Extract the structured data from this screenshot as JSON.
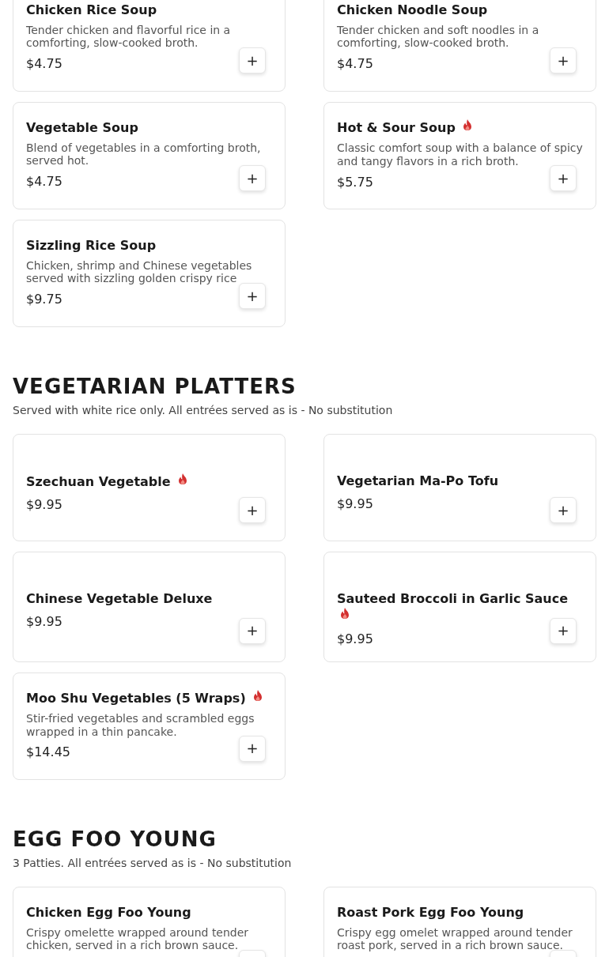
{
  "sections": [
    {
      "items": [
        {
          "name": "Chicken Rice Soup",
          "spicy": false,
          "description": "Tender chicken and flavorful rice in a comforting, slow-cooked broth.",
          "price": "$4.75",
          "add": "+"
        },
        {
          "name": "Chicken Noodle Soup",
          "spicy": false,
          "description": "Tender chicken and soft noodles in a comforting, slow-cooked broth.",
          "price": "$4.75",
          "add": "+"
        },
        {
          "name": "Vegetable Soup",
          "spicy": false,
          "description": "Blend of vegetables in a comforting broth, served hot.",
          "price": "$4.75",
          "add": "+"
        },
        {
          "name": "Hot & Sour Soup",
          "spicy": true,
          "description": "Classic comfort soup with a balance of spicy and tangy flavors in a rich broth.",
          "price": "$5.75",
          "add": "+"
        },
        {
          "name": "Sizzling Rice Soup",
          "spicy": false,
          "description": "Chicken, shrimp and Chinese vegetables served with sizzling golden crispy rice",
          "price": "$9.75",
          "add": "+"
        }
      ]
    },
    {
      "title": "VEGETARIAN PLATTERS",
      "subtitle": "Served with white rice only. All entrées served as is - No substitution",
      "items": [
        {
          "name": "Szechuan Vegetable",
          "spicy": true,
          "price": "$9.95",
          "add": "+"
        },
        {
          "name": "Vegetarian Ma-Po Tofu",
          "spicy": false,
          "price": "$9.95",
          "add": "+"
        },
        {
          "name": "Chinese Vegetable Deluxe",
          "spicy": false,
          "price": "$9.95",
          "add": "+"
        },
        {
          "name": "Sauteed Broccoli in Garlic Sauce",
          "spicy": true,
          "price": "$9.95",
          "add": "+"
        },
        {
          "name": "Moo Shu Vegetables (5 Wraps)",
          "spicy": true,
          "description": "Stir-fried vegetables and scrambled eggs wrapped in a thin pancake.",
          "price": "$14.45",
          "add": "+"
        }
      ]
    },
    {
      "title": "EGG FOO YOUNG",
      "subtitle": "3 Patties. All entrées served as is - No substitution",
      "items": [
        {
          "name": "Chicken Egg Foo Young",
          "spicy": false,
          "description": "Crispy omelette wrapped around tender chicken, served in a rich brown sauce."
        },
        {
          "name": "Roast Pork Egg Foo Young",
          "spicy": false,
          "description": "Crispy egg omelet wrapped around tender roast pork, served in a rich brown sauce."
        }
      ]
    }
  ]
}
